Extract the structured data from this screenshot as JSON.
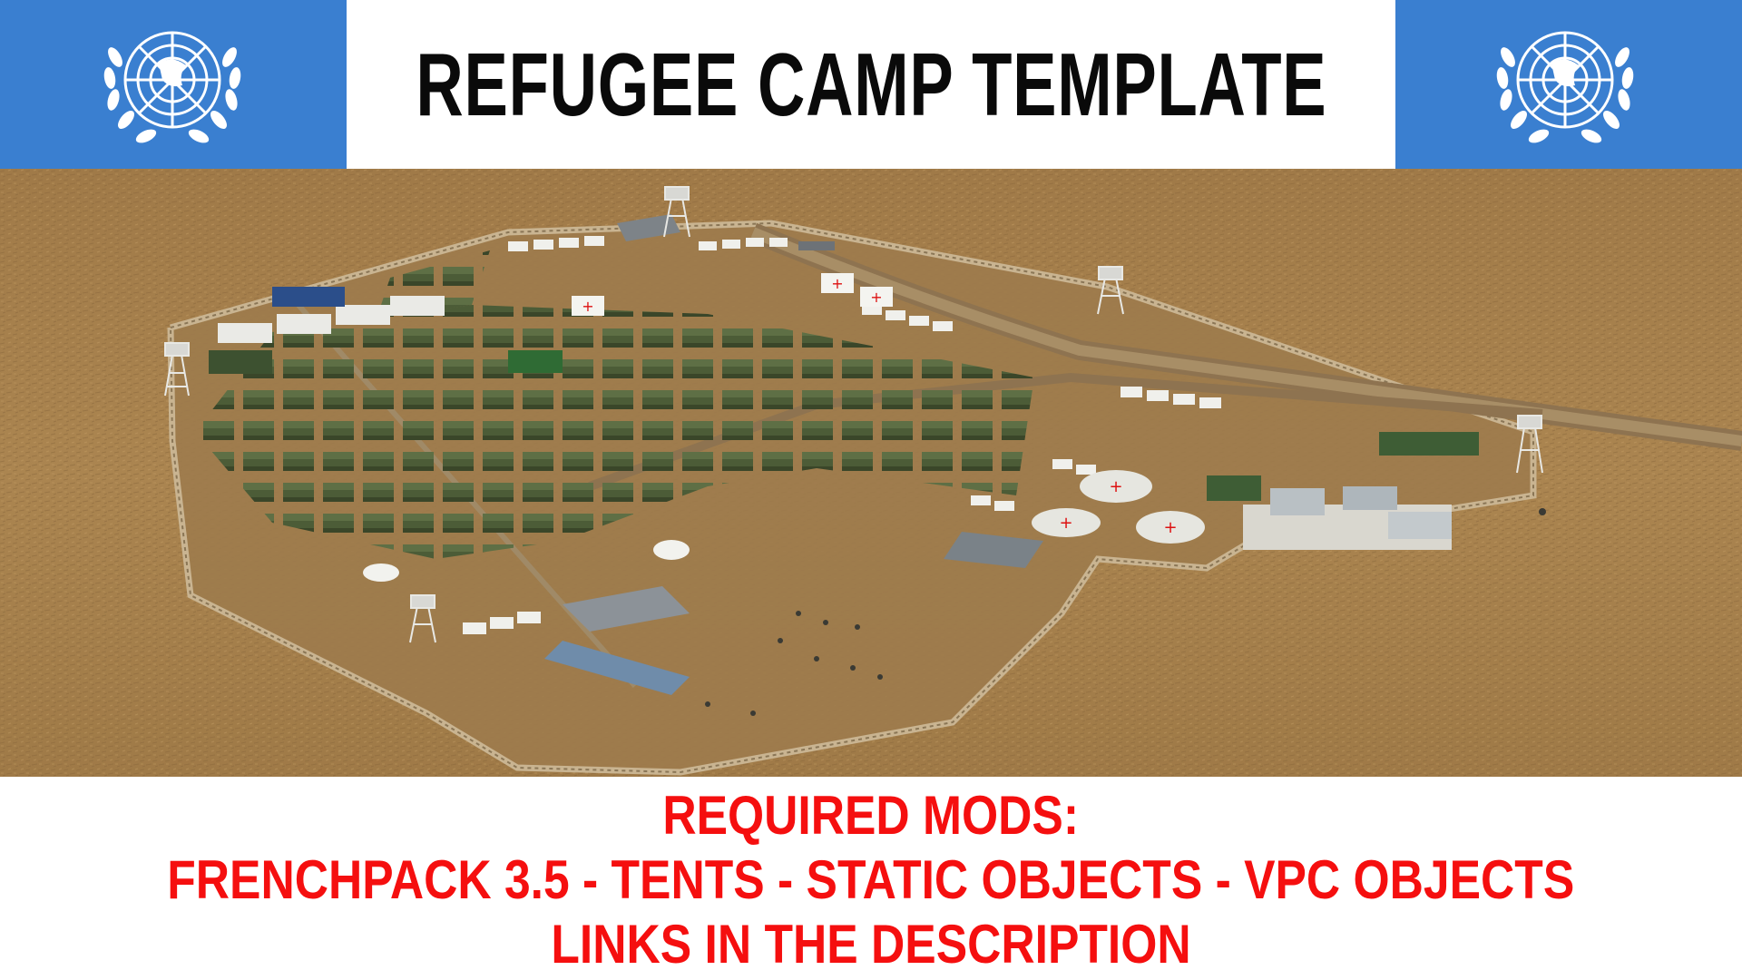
{
  "header": {
    "title": "REFUGEE CAMP TEMPLATE",
    "banner_color": "#3a7fd0",
    "emblem_icon": "un-emblem-icon"
  },
  "footer": {
    "line1": "REQUIRED MODS:",
    "line2": "FRENCHPACK 3.5 - TENTS - STATIC OBJECTS - VPC OBJECTS",
    "line3": "LINKS IN THE DESCRIPTION",
    "text_color": "#f50f0f"
  },
  "scene": {
    "terrain_color": "#a9844f",
    "tent_color": "#4a5a36"
  }
}
